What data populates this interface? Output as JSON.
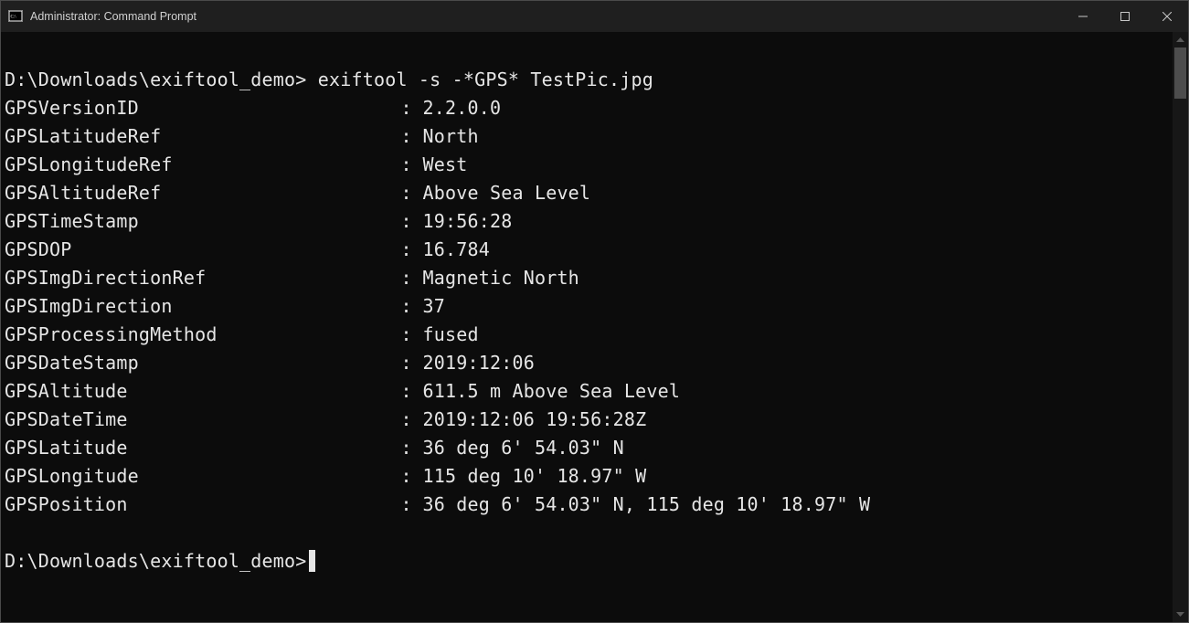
{
  "window": {
    "title": "Administrator: Command Prompt"
  },
  "prompt1": {
    "path": "D:\\Downloads\\exiftool_demo>",
    "command": " exiftool -s -*GPS* TestPic.jpg"
  },
  "rows": [
    {
      "label": "GPSVersionID",
      "value": "2.2.0.0"
    },
    {
      "label": "GPSLatitudeRef",
      "value": "North"
    },
    {
      "label": "GPSLongitudeRef",
      "value": "West"
    },
    {
      "label": "GPSAltitudeRef",
      "value": "Above Sea Level"
    },
    {
      "label": "GPSTimeStamp",
      "value": "19:56:28"
    },
    {
      "label": "GPSDOP",
      "value": "16.784"
    },
    {
      "label": "GPSImgDirectionRef",
      "value": "Magnetic North"
    },
    {
      "label": "GPSImgDirection",
      "value": "37"
    },
    {
      "label": "GPSProcessingMethod",
      "value": "fused"
    },
    {
      "label": "GPSDateStamp",
      "value": "2019:12:06"
    },
    {
      "label": "GPSAltitude",
      "value": "611.5 m Above Sea Level"
    },
    {
      "label": "GPSDateTime",
      "value": "2019:12:06 19:56:28Z"
    },
    {
      "label": "GPSLatitude",
      "value": "36 deg 6' 54.03\" N"
    },
    {
      "label": "GPSLongitude",
      "value": "115 deg 10' 18.97\" W"
    },
    {
      "label": "GPSPosition",
      "value": "36 deg 6' 54.03\" N, 115 deg 10' 18.97\" W"
    }
  ],
  "prompt2": {
    "path": "D:\\Downloads\\exiftool_demo>"
  }
}
